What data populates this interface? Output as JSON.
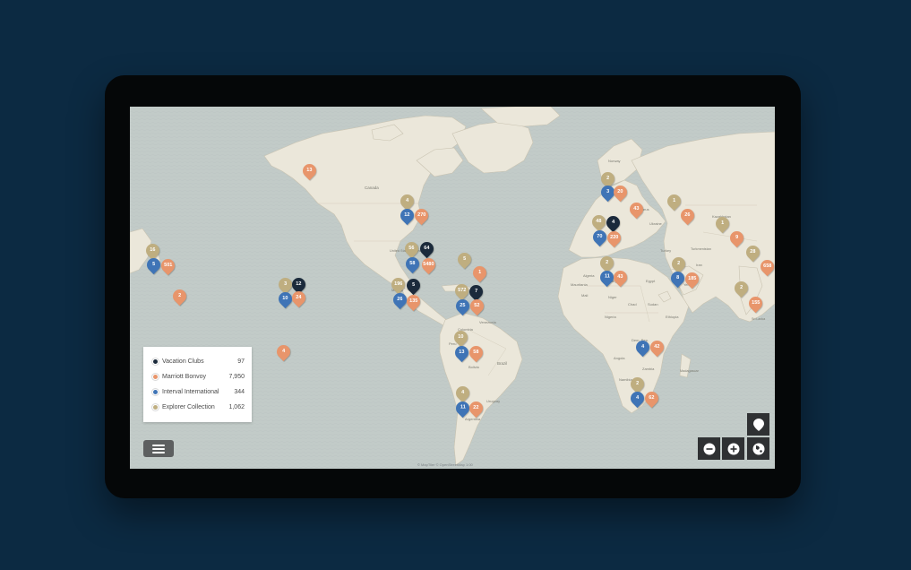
{
  "colors": {
    "vacation_clubs": "#1b2a3b",
    "marriott_bonvoy": "#e8956b",
    "interval_international": "#3f74b6",
    "explorer_collection": "#bfae80"
  },
  "legend": {
    "items": [
      {
        "key": "vacation_clubs",
        "label": "Vacation Clubs",
        "count": "97"
      },
      {
        "key": "marriott_bonvoy",
        "label": "Marriott Bonvoy",
        "count": "7,950"
      },
      {
        "key": "interval_international",
        "label": "Interval International",
        "count": "344"
      },
      {
        "key": "explorer_collection",
        "label": "Explorer Collection",
        "count": "1,062"
      }
    ]
  },
  "map": {
    "labels": {
      "canada": "Canada",
      "usa": "United States of America",
      "brazil": "Brazil",
      "mexico": "Mexico",
      "colombia": "Colombia",
      "bolivia": "Bolivia",
      "argentina": "Argentina",
      "peru": "Peru",
      "venezuela": "Venezuela",
      "uruguay": "Uruguay",
      "algeria": "Algeria",
      "libya": "Libya",
      "egypt": "Egypt",
      "niger": "Niger",
      "chad": "Chad",
      "sudan": "Sudan",
      "ethiopia": "Ethiopia",
      "angola": "Angola",
      "zambia": "Zambia",
      "namibia": "Namibia",
      "dem_rep": "Dem. Rep.",
      "madagascar": "Madagascar",
      "iran": "Iran",
      "turkey": "Turkey",
      "ukraine": "Ukraine",
      "kazakhstan": "Kazakhstan",
      "turkmenistan": "Turkmenistan",
      "sri_lanka": "Sri Lanka",
      "norway": "Norway",
      "belarus": "Belarus",
      "mali": "Mali",
      "mauritania": "Mauritania",
      "nigeria": "Nigeria",
      "yemen": "Yemen"
    },
    "attribution": "© MapTiler  © OpenStreetMap   1:00"
  },
  "markers": [
    {
      "type": "marriott_bonvoy",
      "label": "13"
    },
    {
      "type": "explorer_collection",
      "label": "4"
    },
    {
      "type": "marriott_bonvoy",
      "label": "270"
    },
    {
      "type": "interval_international",
      "label": "12"
    },
    {
      "type": "explorer_collection",
      "label": "56"
    },
    {
      "type": "vacation_clubs",
      "label": "64"
    },
    {
      "type": "interval_international",
      "label": "58"
    },
    {
      "type": "marriott_bonvoy",
      "label": "5480"
    },
    {
      "type": "explorer_collection",
      "label": "5"
    },
    {
      "type": "marriott_bonvoy",
      "label": "1"
    },
    {
      "type": "explorer_collection",
      "label": "3"
    },
    {
      "type": "vacation_clubs",
      "label": "12"
    },
    {
      "type": "interval_international",
      "label": "10"
    },
    {
      "type": "marriott_bonvoy",
      "label": "24"
    },
    {
      "type": "explorer_collection",
      "label": "16"
    },
    {
      "type": "interval_international",
      "label": "5"
    },
    {
      "type": "marriott_bonvoy",
      "label": "501"
    },
    {
      "type": "marriott_bonvoy",
      "label": "2"
    },
    {
      "type": "explorer_collection",
      "label": "196"
    },
    {
      "type": "vacation_clubs",
      "label": "5"
    },
    {
      "type": "interval_international",
      "label": "26"
    },
    {
      "type": "marriott_bonvoy",
      "label": "135"
    },
    {
      "type": "explorer_collection",
      "label": "572"
    },
    {
      "type": "vacation_clubs",
      "label": "7"
    },
    {
      "type": "interval_international",
      "label": "25"
    },
    {
      "type": "marriott_bonvoy",
      "label": "52"
    },
    {
      "type": "marriott_bonvoy",
      "label": "4"
    },
    {
      "type": "explorer_collection",
      "label": "10"
    },
    {
      "type": "interval_international",
      "label": "13"
    },
    {
      "type": "marriott_bonvoy",
      "label": "58"
    },
    {
      "type": "explorer_collection",
      "label": "4"
    },
    {
      "type": "interval_international",
      "label": "11"
    },
    {
      "type": "marriott_bonvoy",
      "label": "22"
    },
    {
      "type": "explorer_collection",
      "label": "2"
    },
    {
      "type": "interval_international",
      "label": "3"
    },
    {
      "type": "marriott_bonvoy",
      "label": "20"
    },
    {
      "type": "marriott_bonvoy",
      "label": "43"
    },
    {
      "type": "vacation_clubs",
      "label": "4"
    },
    {
      "type": "explorer_collection",
      "label": "48"
    },
    {
      "type": "interval_international",
      "label": "70"
    },
    {
      "type": "marriott_bonvoy",
      "label": "220"
    },
    {
      "type": "explorer_collection",
      "label": "1"
    },
    {
      "type": "marriott_bonvoy",
      "label": "26"
    },
    {
      "type": "explorer_collection",
      "label": "1"
    },
    {
      "type": "marriott_bonvoy",
      "label": "9"
    },
    {
      "type": "explorer_collection",
      "label": "2"
    },
    {
      "type": "interval_international",
      "label": "11"
    },
    {
      "type": "marriott_bonvoy",
      "label": "43"
    },
    {
      "type": "explorer_collection",
      "label": "2"
    },
    {
      "type": "interval_international",
      "label": "8"
    },
    {
      "type": "marriott_bonvoy",
      "label": "185"
    },
    {
      "type": "explorer_collection",
      "label": "28"
    },
    {
      "type": "marriott_bonvoy",
      "label": "658"
    },
    {
      "type": "explorer_collection",
      "label": "2"
    },
    {
      "type": "marriott_bonvoy",
      "label": "155"
    },
    {
      "type": "interval_international",
      "label": "4"
    },
    {
      "type": "marriott_bonvoy",
      "label": "42"
    },
    {
      "type": "explorer_collection",
      "label": "2"
    },
    {
      "type": "interval_international",
      "label": "4"
    },
    {
      "type": "marriott_bonvoy",
      "label": "62"
    }
  ]
}
